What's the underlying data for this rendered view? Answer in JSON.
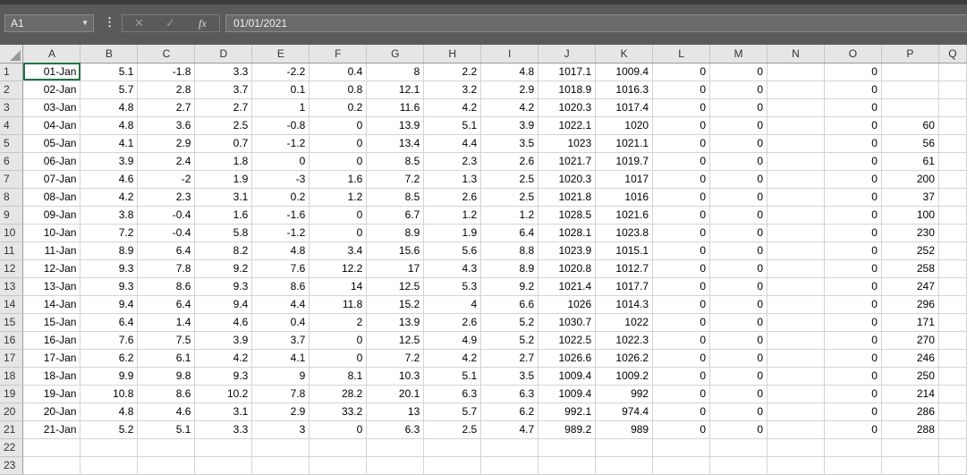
{
  "toolbar": {
    "name_box": "A1",
    "more_symbol": "⋮",
    "cancel_symbol": "✕",
    "enter_symbol": "✓",
    "fx_symbol": "fx",
    "formula": "01/01/2021"
  },
  "columns": [
    "A",
    "B",
    "C",
    "D",
    "E",
    "F",
    "G",
    "H",
    "I",
    "J",
    "K",
    "L",
    "M",
    "N",
    "O",
    "P",
    "Q"
  ],
  "rows": [
    {
      "n": "1",
      "cells": [
        "01-Jan",
        "5.1",
        "-1.8",
        "3.3",
        "-2.2",
        "0.4",
        "8",
        "2.2",
        "4.8",
        "1017.1",
        "1009.4",
        "0",
        "0",
        "",
        "0",
        "",
        ""
      ]
    },
    {
      "n": "2",
      "cells": [
        "02-Jan",
        "5.7",
        "2.8",
        "3.7",
        "0.1",
        "0.8",
        "12.1",
        "3.2",
        "2.9",
        "1018.9",
        "1016.3",
        "0",
        "0",
        "",
        "0",
        "",
        ""
      ]
    },
    {
      "n": "3",
      "cells": [
        "03-Jan",
        "4.8",
        "2.7",
        "2.7",
        "1",
        "0.2",
        "11.6",
        "4.2",
        "4.2",
        "1020.3",
        "1017.4",
        "0",
        "0",
        "",
        "0",
        "",
        ""
      ]
    },
    {
      "n": "4",
      "cells": [
        "04-Jan",
        "4.8",
        "3.6",
        "2.5",
        "-0.8",
        "0",
        "13.9",
        "5.1",
        "3.9",
        "1022.1",
        "1020",
        "0",
        "0",
        "",
        "0",
        "60",
        ""
      ]
    },
    {
      "n": "5",
      "cells": [
        "05-Jan",
        "4.1",
        "2.9",
        "0.7",
        "-1.2",
        "0",
        "13.4",
        "4.4",
        "3.5",
        "1023",
        "1021.1",
        "0",
        "0",
        "",
        "0",
        "56",
        ""
      ]
    },
    {
      "n": "6",
      "cells": [
        "06-Jan",
        "3.9",
        "2.4",
        "1.8",
        "0",
        "0",
        "8.5",
        "2.3",
        "2.6",
        "1021.7",
        "1019.7",
        "0",
        "0",
        "",
        "0",
        "61",
        ""
      ]
    },
    {
      "n": "7",
      "cells": [
        "07-Jan",
        "4.6",
        "-2",
        "1.9",
        "-3",
        "1.6",
        "7.2",
        "1.3",
        "2.5",
        "1020.3",
        "1017",
        "0",
        "0",
        "",
        "0",
        "200",
        ""
      ]
    },
    {
      "n": "8",
      "cells": [
        "08-Jan",
        "4.2",
        "2.3",
        "3.1",
        "0.2",
        "1.2",
        "8.5",
        "2.6",
        "2.5",
        "1021.8",
        "1016",
        "0",
        "0",
        "",
        "0",
        "37",
        ""
      ]
    },
    {
      "n": "9",
      "cells": [
        "09-Jan",
        "3.8",
        "-0.4",
        "1.6",
        "-1.6",
        "0",
        "6.7",
        "1.2",
        "1.2",
        "1028.5",
        "1021.6",
        "0",
        "0",
        "",
        "0",
        "100",
        ""
      ]
    },
    {
      "n": "10",
      "cells": [
        "10-Jan",
        "7.2",
        "-0.4",
        "5.8",
        "-1.2",
        "0",
        "8.9",
        "1.9",
        "6.4",
        "1028.1",
        "1023.8",
        "0",
        "0",
        "",
        "0",
        "230",
        ""
      ]
    },
    {
      "n": "11",
      "cells": [
        "11-Jan",
        "8.9",
        "6.4",
        "8.2",
        "4.8",
        "3.4",
        "15.6",
        "5.6",
        "8.8",
        "1023.9",
        "1015.1",
        "0",
        "0",
        "",
        "0",
        "252",
        ""
      ]
    },
    {
      "n": "12",
      "cells": [
        "12-Jan",
        "9.3",
        "7.8",
        "9.2",
        "7.6",
        "12.2",
        "17",
        "4.3",
        "8.9",
        "1020.8",
        "1012.7",
        "0",
        "0",
        "",
        "0",
        "258",
        ""
      ]
    },
    {
      "n": "13",
      "cells": [
        "13-Jan",
        "9.3",
        "8.6",
        "9.3",
        "8.6",
        "14",
        "12.5",
        "5.3",
        "9.2",
        "1021.4",
        "1017.7",
        "0",
        "0",
        "",
        "0",
        "247",
        ""
      ]
    },
    {
      "n": "14",
      "cells": [
        "14-Jan",
        "9.4",
        "6.4",
        "9.4",
        "4.4",
        "11.8",
        "15.2",
        "4",
        "6.6",
        "1026",
        "1014.3",
        "0",
        "0",
        "",
        "0",
        "296",
        ""
      ]
    },
    {
      "n": "15",
      "cells": [
        "15-Jan",
        "6.4",
        "1.4",
        "4.6",
        "0.4",
        "2",
        "13.9",
        "2.6",
        "5.2",
        "1030.7",
        "1022",
        "0",
        "0",
        "",
        "0",
        "171",
        ""
      ]
    },
    {
      "n": "16",
      "cells": [
        "16-Jan",
        "7.6",
        "7.5",
        "3.9",
        "3.7",
        "0",
        "12.5",
        "4.9",
        "5.2",
        "1022.5",
        "1022.3",
        "0",
        "0",
        "",
        "0",
        "270",
        ""
      ]
    },
    {
      "n": "17",
      "cells": [
        "17-Jan",
        "6.2",
        "6.1",
        "4.2",
        "4.1",
        "0",
        "7.2",
        "4.2",
        "2.7",
        "1026.6",
        "1026.2",
        "0",
        "0",
        "",
        "0",
        "246",
        ""
      ]
    },
    {
      "n": "18",
      "cells": [
        "18-Jan",
        "9.9",
        "9.8",
        "9.3",
        "9",
        "8.1",
        "10.3",
        "5.1",
        "3.5",
        "1009.4",
        "1009.2",
        "0",
        "0",
        "",
        "0",
        "250",
        ""
      ]
    },
    {
      "n": "19",
      "cells": [
        "19-Jan",
        "10.8",
        "8.6",
        "10.2",
        "7.8",
        "28.2",
        "20.1",
        "6.3",
        "6.3",
        "1009.4",
        "992",
        "0",
        "0",
        "",
        "0",
        "214",
        ""
      ]
    },
    {
      "n": "20",
      "cells": [
        "20-Jan",
        "4.8",
        "4.6",
        "3.1",
        "2.9",
        "33.2",
        "13",
        "5.7",
        "6.2",
        "992.1",
        "974.4",
        "0",
        "0",
        "",
        "0",
        "286",
        ""
      ]
    },
    {
      "n": "21",
      "cells": [
        "21-Jan",
        "5.2",
        "5.1",
        "3.3",
        "3",
        "0",
        "6.3",
        "2.5",
        "4.7",
        "989.2",
        "989",
        "0",
        "0",
        "",
        "0",
        "288",
        ""
      ]
    },
    {
      "n": "22",
      "cells": [
        "",
        "",
        "",
        "",
        "",
        "",
        "",
        "",
        "",
        "",
        "",
        "",
        "",
        "",
        "",
        "",
        ""
      ]
    },
    {
      "n": "23",
      "cells": [
        "",
        "",
        "",
        "",
        "",
        "",
        "",
        "",
        "",
        "",
        "",
        "",
        "",
        "",
        "",
        "",
        ""
      ]
    }
  ]
}
